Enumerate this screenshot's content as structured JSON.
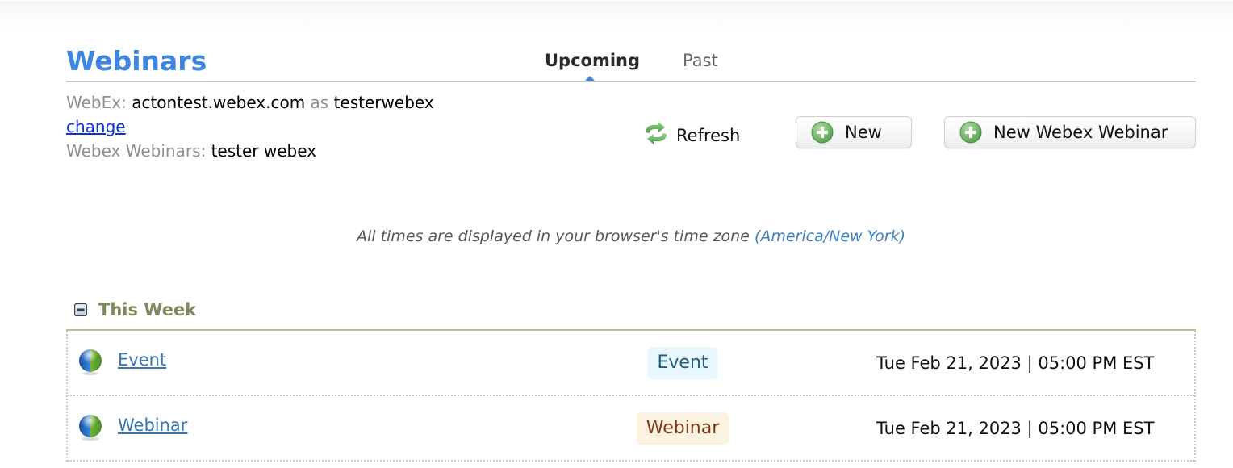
{
  "header": {
    "title": "Webinars",
    "tabs": [
      {
        "label": "Upcoming",
        "active": true
      },
      {
        "label": "Past",
        "active": false
      }
    ]
  },
  "account": {
    "webex_label": "WebEx:",
    "webex_site": "actontest.webex.com",
    "as_label": "as",
    "webex_user": "testerwebex",
    "change_link": "change",
    "webinars_label": "Webex Webinars:",
    "webinars_user": "tester webex"
  },
  "toolbar": {
    "refresh_label": "Refresh",
    "new_label": "New",
    "new_webex_label": "New Webex Webinar"
  },
  "timezone_note": {
    "text": "All times are displayed in your browser's time zone",
    "zone": "(America/New York)"
  },
  "sections": [
    {
      "title": "This Week",
      "collapsed": false,
      "rows": [
        {
          "name": "Event",
          "type": "Event",
          "datetime": "Tue Feb 21, 2023 | 05:00 PM EST"
        },
        {
          "name": "Webinar",
          "type": "Webinar",
          "datetime": "Tue Feb 21, 2023 | 05:00 PM EST"
        }
      ]
    }
  ],
  "colors": {
    "title": "#3f86e0",
    "section_title": "#7a8a5a",
    "link": "#3576b0",
    "event_badge_bg": "#e8f7fd",
    "webinar_badge_bg": "#fbf2e2"
  }
}
